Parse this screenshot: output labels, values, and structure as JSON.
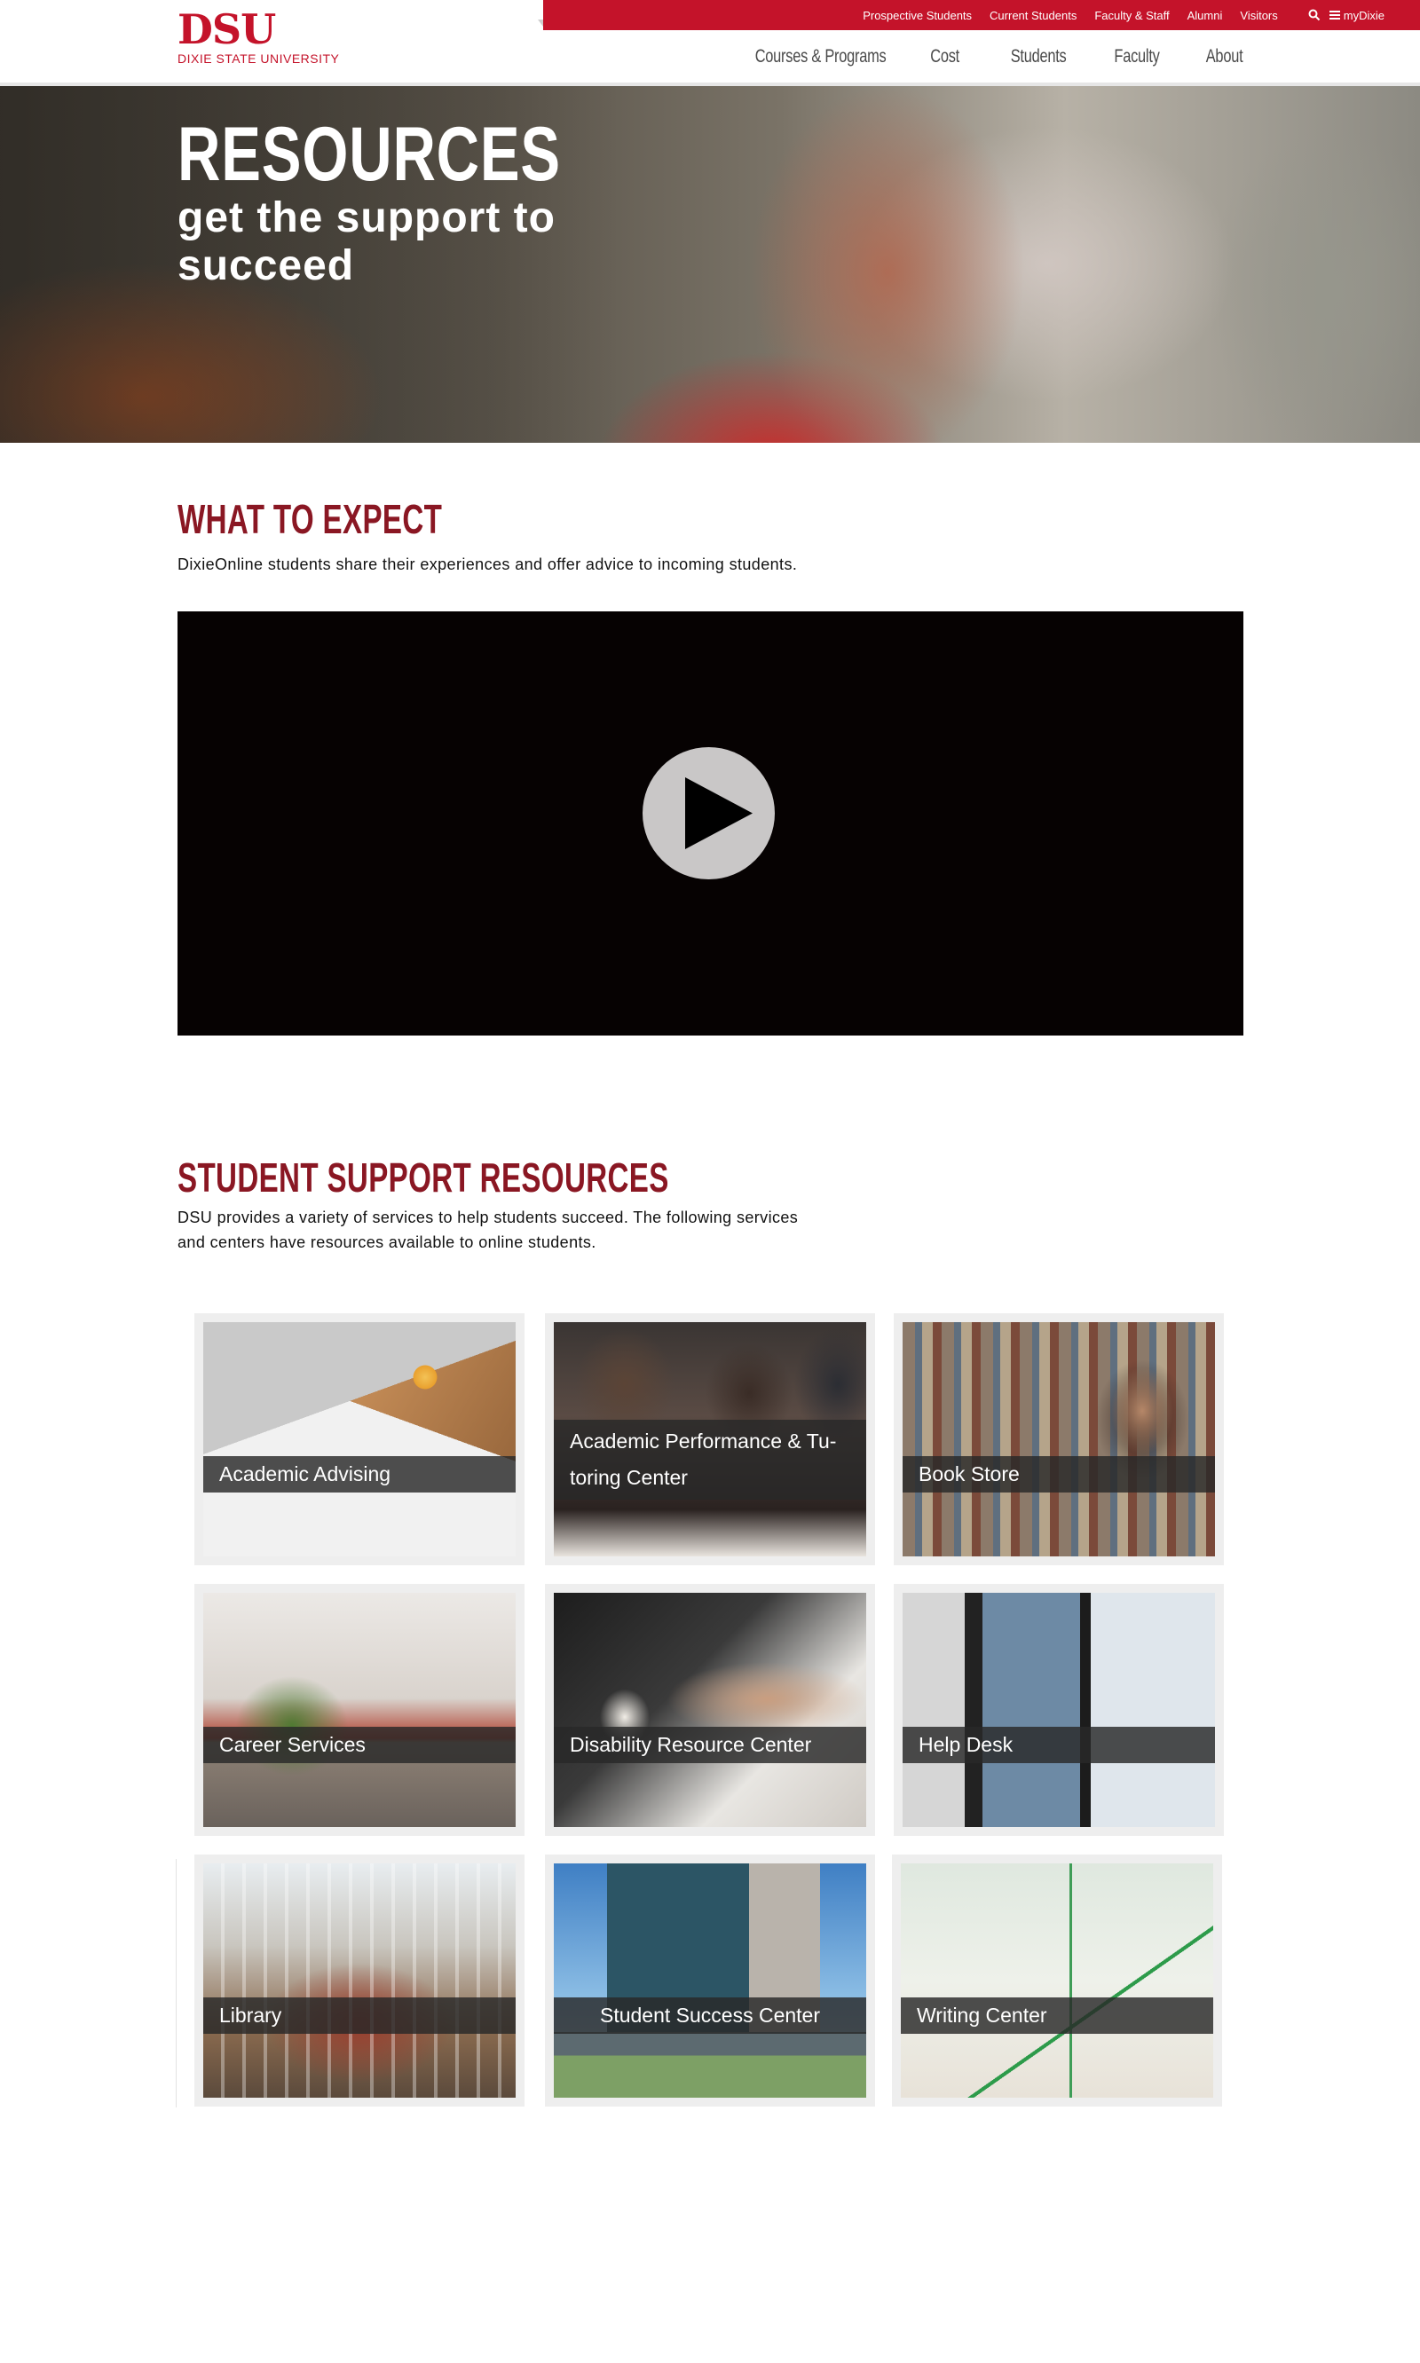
{
  "site": {
    "logo_text": "DSU",
    "logo_subtext": "DIXIE STATE UNIVERSITY",
    "brand_color": "#c4132a",
    "heading_color": "#8a1723"
  },
  "topbar": {
    "links": [
      "Prospective Students",
      "Current Students",
      "Faculty & Staff",
      "Alumni",
      "Visitors"
    ],
    "search_icon": "search-icon",
    "mydixie_label": "myDixie",
    "mydixie_icon": "menu-icon"
  },
  "mainnav": {
    "items": [
      "Courses & Programs",
      "Cost",
      "Students",
      "Faculty",
      "About"
    ]
  },
  "hero": {
    "title": "RESOURCES",
    "subtitle": "get the support to succeed"
  },
  "expect": {
    "title": "WHAT TO EXPECT",
    "text": "DixieOnline students share their experiences and offer advice to incoming students.",
    "video_icon": "play-icon"
  },
  "support": {
    "title": "STUDENT SUPPORT RESOURCES",
    "text_line1": "DSU provides a variety of services to help students succeed. The following services",
    "text_line2": "and centers have resources available to online students.",
    "cards": [
      {
        "label": "Academic Advising"
      },
      {
        "label": "Academic Performance & Tu-",
        "label_line2": "toring Center"
      },
      {
        "label": "Book Store"
      },
      {
        "label": "Career Services"
      },
      {
        "label": "Disability Resource Center"
      },
      {
        "label": "Help Desk"
      },
      {
        "label": "Library"
      },
      {
        "label": "Student Success Center"
      },
      {
        "label": "Writing Center"
      }
    ]
  }
}
